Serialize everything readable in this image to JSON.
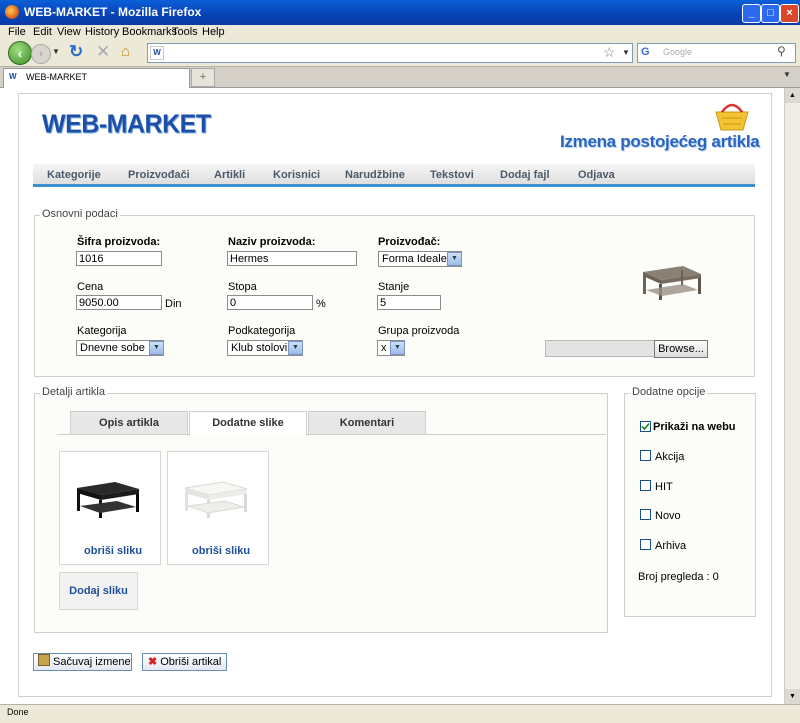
{
  "window": {
    "title": "WEB-MARKET - Mozilla Firefox",
    "min": "_",
    "max": "□",
    "close": "×"
  },
  "menu": [
    "File",
    "Edit",
    "View",
    "History",
    "Bookmarks",
    "Tools",
    "Help"
  ],
  "browser": {
    "search_placeholder": "Google",
    "tab_label": "WEB-MARKET",
    "newtab": "+"
  },
  "site": {
    "logo": "WEB-MARKET",
    "heading": "Izmena postojećeg artikla"
  },
  "nav": [
    "Kategorije",
    "Proizvođači",
    "Artikli",
    "Korisnici",
    "Narudžbine",
    "Tekstovi",
    "Dodaj fajl",
    "Odjava"
  ],
  "osnovni": {
    "legend": "Osnovni podaci",
    "sifra_label": "Šifra proizvoda:",
    "sifra_value": "1016",
    "naziv_label": "Naziv proizvoda:",
    "naziv_value": "Hermes",
    "proizvodjac_label": "Proizvođač:",
    "proizvodjac_value": "Forma Ideale",
    "cena_label": "Cena",
    "cena_value": "9050.00",
    "cena_unit": "Din",
    "stopa_label": "Stopa",
    "stopa_value": "0",
    "stopa_unit": "%",
    "stanje_label": "Stanje",
    "stanje_value": "5",
    "kategorija_label": "Kategorija",
    "kategorija_value": "Dnevne sobe",
    "podkategorija_label": "Podkategorija",
    "podkategorija_value": "Klub stolovi",
    "grupa_label": "Grupa proizvoda",
    "grupa_value": "x",
    "browse_label": "Browse..."
  },
  "detalji": {
    "legend": "Detalji artikla",
    "tabs": [
      "Opis artikla",
      "Dodatne slike",
      "Komentari"
    ],
    "active_tab": "Dodatne slike",
    "delete_image": "obriši sliku",
    "add_image": "Dodaj sliku"
  },
  "opcije": {
    "legend": "Dodatne opcije",
    "items": [
      {
        "label": "Prikaži na webu",
        "checked": true
      },
      {
        "label": "Akcija",
        "checked": false
      },
      {
        "label": "HIT",
        "checked": false
      },
      {
        "label": "Novo",
        "checked": false
      },
      {
        "label": "Arhiva",
        "checked": false
      }
    ],
    "views": "Broj pregleda : 0"
  },
  "actions": {
    "save": "Sačuvaj izmene",
    "delete": "Obriši artikal"
  },
  "status": "Done"
}
